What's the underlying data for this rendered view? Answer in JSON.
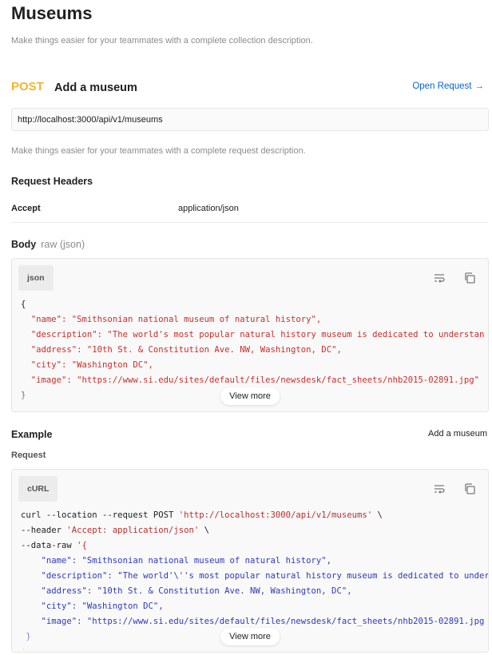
{
  "collection": {
    "title": "Museums",
    "description": "Make things easier for your teammates with a complete collection description."
  },
  "request": {
    "method": "POST",
    "name": "Add a museum",
    "open_label": "Open Request",
    "url": "http://localhost:3000/api/v1/museums",
    "description": "Make things easier for your teammates with a complete request description."
  },
  "headers": {
    "title": "Request Headers",
    "rows": [
      {
        "key": "Accept",
        "value": "application/json"
      }
    ]
  },
  "body": {
    "title": "Body",
    "mode": "raw (json)",
    "lang": "json",
    "view_more": "View more",
    "code": [
      "{",
      "\"name\": \"Smithsonian national museum of natural history\",",
      "\"description\": \"The world's most popular natural history museum is dedicated to understan",
      "\"address\": \"10th St. & Constitution Ave. NW, Washington, DC\",",
      "\"city\": \"Washington DC\",",
      "\"image\": \"https://www.si.edu/sites/default/files/newsdesk/fact_sheets/nhb2015-02891.jpg\"",
      "}"
    ]
  },
  "example": {
    "title": "Example",
    "selected": "Add a museum",
    "request_label": "Request",
    "lang": "cURL",
    "view_more": "View more",
    "code": {
      "line1_cmd": "curl --location --request POST ",
      "line1_url": "'http://localhost:3000/api/v1/museums'",
      "line1_end": " \\",
      "line2_cmd": "--header ",
      "line2_val": "'Accept: application/json'",
      "line2_end": " \\",
      "line3_cmd": "--data-raw ",
      "line3_val": "'{",
      "name_line": "\"name\": \"Smithsonian national museum of natural history\",",
      "desc_line": "\"description\": \"The world'\\''s most popular natural history museum is dedicated to under",
      "addr_line": "\"address\": \"10th St. & Constitution Ave. NW, Washington, DC\",",
      "city_line": "\"city\": \"Washington DC\",",
      "image_line": "\"image\": \"https://www.si.edu/sites/default/files/newsdesk/fact_sheets/nhb2015-02891.jpg",
      "close_line": "}",
      "end_line": "'"
    }
  },
  "icons": [
    "wrap-lines-icon",
    "copy-icon",
    "arrow-right-icon"
  ],
  "colors": {
    "method_post": "#f4b42b",
    "link": "#0265d2",
    "json_key": "#c4302b",
    "json_string": "#2e3ab8"
  }
}
